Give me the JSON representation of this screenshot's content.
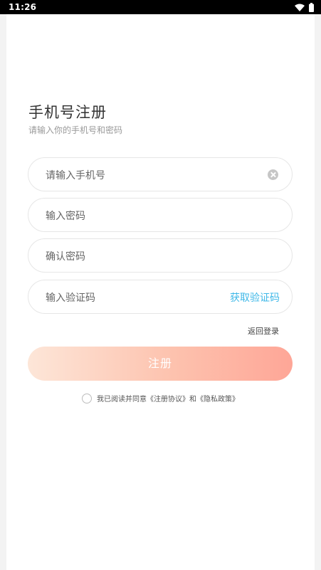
{
  "status_bar": {
    "time": "11:26",
    "icons": [
      "wifi-icon",
      "battery-icon"
    ]
  },
  "form": {
    "title": "手机号注册",
    "subtitle": "请输入你的手机号和密码",
    "phone_placeholder": "请输入手机号",
    "password_placeholder": "输入密码",
    "confirm_placeholder": "确认密码",
    "code_placeholder": "输入验证码",
    "get_code_label": "获取验证码",
    "back_login_label": "返回登录",
    "register_label": "注册",
    "agreement_text": "我已阅读并同意《注册协议》和《隐私政策》"
  },
  "colors": {
    "accent_link": "#3fb8e8",
    "button_gradient_start": "#fde6d8",
    "button_gradient_end": "#fea697"
  }
}
